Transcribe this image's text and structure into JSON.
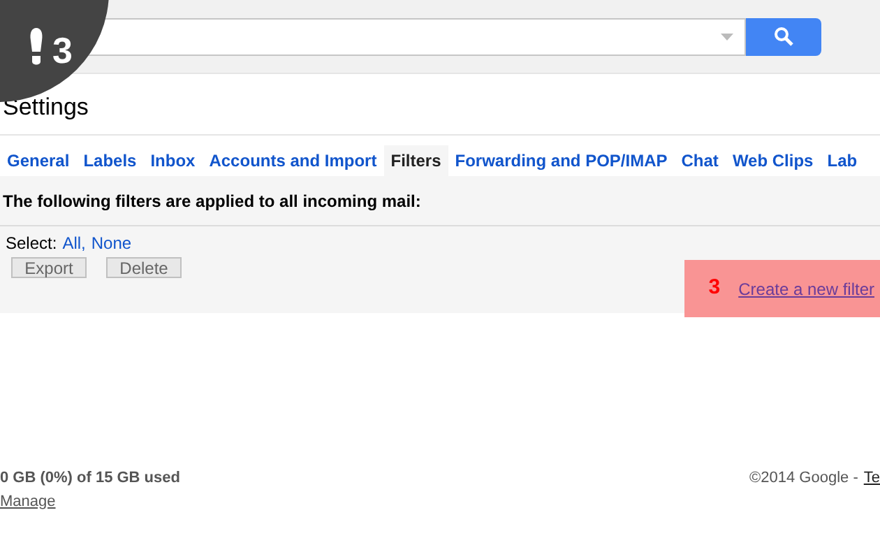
{
  "step_badge": {
    "number": "3"
  },
  "page_title": "Settings",
  "tabs": [
    {
      "label": "General",
      "selected": false
    },
    {
      "label": "Labels",
      "selected": false
    },
    {
      "label": "Inbox",
      "selected": false
    },
    {
      "label": "Accounts and Import",
      "selected": false
    },
    {
      "label": "Filters",
      "selected": true
    },
    {
      "label": "Forwarding and POP/IMAP",
      "selected": false
    },
    {
      "label": "Chat",
      "selected": false
    },
    {
      "label": "Web Clips",
      "selected": false
    },
    {
      "label": "Lab",
      "selected": false
    }
  ],
  "filters_heading": "The following filters are applied to all incoming mail:",
  "select": {
    "label": "Select:",
    "options": [
      "All",
      "None"
    ],
    "separator": ","
  },
  "buttons": [
    "Export",
    "Delete"
  ],
  "callout": {
    "number": "3",
    "link": "Create a new filter"
  },
  "footer": {
    "usage": "0 GB (0%) of 15 GB used",
    "manage": "Manage",
    "copyright": "©2014 Google -",
    "terms": "Te"
  }
}
